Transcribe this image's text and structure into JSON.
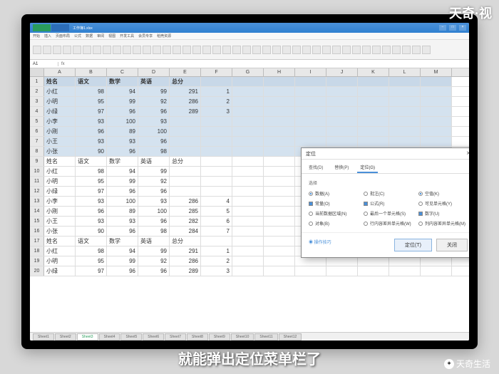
{
  "watermark_top": "天奇·视",
  "subtitle": "就能弹出定位菜单栏了",
  "watermark_bottom": "天奇生活",
  "titlebar": {
    "filename": "工作簿1.xlsx"
  },
  "menu": [
    "开始",
    "插入",
    "页面布局",
    "公式",
    "数据",
    "审阅",
    "视图",
    "开发工具",
    "会员专享",
    "稻壳资源"
  ],
  "cell_ref": "A1",
  "cols": [
    "A",
    "B",
    "C",
    "D",
    "E",
    "F",
    "G",
    "H",
    "I",
    "J",
    "K",
    "L",
    "M"
  ],
  "rows": [
    {
      "n": 1,
      "sel": true,
      "hdr": true,
      "c": [
        "姓名",
        "语文",
        "数学",
        "英语",
        "总分",
        "",
        "",
        "",
        "",
        "",
        "",
        "",
        ""
      ]
    },
    {
      "n": 2,
      "sel": true,
      "c": [
        "小红",
        "98",
        "94",
        "99",
        "291",
        "1",
        "",
        "",
        "",
        "",
        "",
        "",
        ""
      ]
    },
    {
      "n": 3,
      "sel": true,
      "c": [
        "小明",
        "95",
        "99",
        "92",
        "286",
        "2",
        "",
        "",
        "",
        "",
        "",
        "",
        ""
      ]
    },
    {
      "n": 4,
      "sel": true,
      "c": [
        "小绿",
        "97",
        "96",
        "96",
        "289",
        "3",
        "",
        "",
        "",
        "",
        "",
        "",
        ""
      ]
    },
    {
      "n": 5,
      "sel": true,
      "c": [
        "小李",
        "93",
        "100",
        "93",
        "",
        "",
        "",
        "",
        "",
        "",
        "",
        "",
        ""
      ]
    },
    {
      "n": 6,
      "sel": true,
      "c": [
        "小刚",
        "96",
        "89",
        "100",
        "",
        "",
        "",
        "",
        "",
        "",
        "",
        "",
        ""
      ]
    },
    {
      "n": 7,
      "sel": true,
      "c": [
        "小王",
        "93",
        "93",
        "96",
        "",
        "",
        "",
        "",
        "",
        "",
        "",
        "",
        ""
      ]
    },
    {
      "n": 8,
      "sel": true,
      "c": [
        "小张",
        "90",
        "96",
        "98",
        "",
        "",
        "",
        "",
        "",
        "",
        "",
        "",
        ""
      ]
    },
    {
      "n": 9,
      "c": [
        "姓名",
        "语文",
        "数学",
        "英语",
        "总分",
        "",
        "",
        "",
        "",
        "",
        "",
        "",
        ""
      ]
    },
    {
      "n": 10,
      "c": [
        "小红",
        "98",
        "94",
        "99",
        "",
        "",
        "",
        "",
        "",
        "",
        "",
        "",
        ""
      ]
    },
    {
      "n": 11,
      "c": [
        "小明",
        "95",
        "99",
        "92",
        "",
        "",
        "",
        "",
        "",
        "",
        "",
        "",
        ""
      ]
    },
    {
      "n": 12,
      "c": [
        "小绿",
        "97",
        "96",
        "96",
        "",
        "",
        "",
        "",
        "",
        "",
        "",
        "",
        ""
      ]
    },
    {
      "n": 13,
      "c": [
        "小李",
        "93",
        "100",
        "93",
        "286",
        "4",
        "",
        "",
        "",
        "",
        "",
        "",
        ""
      ]
    },
    {
      "n": 14,
      "c": [
        "小刚",
        "96",
        "89",
        "100",
        "285",
        "5",
        "",
        "",
        "",
        "",
        "",
        "",
        ""
      ]
    },
    {
      "n": 15,
      "c": [
        "小王",
        "93",
        "93",
        "96",
        "282",
        "6",
        "",
        "",
        "",
        "",
        "",
        "",
        ""
      ]
    },
    {
      "n": 16,
      "c": [
        "小张",
        "90",
        "96",
        "98",
        "284",
        "7",
        "",
        "",
        "",
        "",
        "",
        "",
        ""
      ]
    },
    {
      "n": 17,
      "c": [
        "姓名",
        "语文",
        "数学",
        "英语",
        "总分",
        "",
        "",
        "",
        "",
        "",
        "",
        "",
        ""
      ]
    },
    {
      "n": 18,
      "c": [
        "小红",
        "98",
        "94",
        "99",
        "291",
        "1",
        "",
        "",
        "",
        "",
        "",
        "",
        ""
      ]
    },
    {
      "n": 19,
      "c": [
        "小明",
        "95",
        "99",
        "92",
        "286",
        "2",
        "",
        "",
        "",
        "",
        "",
        "",
        ""
      ]
    },
    {
      "n": 20,
      "c": [
        "小绿",
        "97",
        "96",
        "96",
        "289",
        "3",
        "",
        "",
        "",
        "",
        "",
        "",
        ""
      ]
    }
  ],
  "sheets": [
    "Sheet1",
    "Sheet2",
    "Sheet3",
    "Sheet4",
    "Sheet5",
    "Sheet6",
    "Sheet7",
    "Sheet8",
    "Sheet9",
    "Sheet10",
    "Sheet11",
    "Sheet12"
  ],
  "active_sheet": 2,
  "dialog": {
    "title": "定位",
    "tabs": [
      "查找(D)",
      "替换(P)",
      "定位(G)"
    ],
    "section": "选择",
    "options": [
      {
        "label": "数据(A)",
        "type": "radio",
        "checked": true
      },
      {
        "label": "批注(C)",
        "type": "radio"
      },
      {
        "label": "空值(K)",
        "type": "radio",
        "checked": true
      },
      {
        "label": "常量(O)",
        "type": "check",
        "checked": true
      },
      {
        "label": "公式(R)",
        "type": "check",
        "checked": true
      },
      {
        "label": "可见单元格(Y)",
        "type": "radio"
      },
      {
        "label": "当前数据区域(N)",
        "type": "radio"
      },
      {
        "label": "最后一个单元格(S)",
        "type": "radio"
      },
      {
        "label": "数字(U)",
        "type": "check",
        "checked": true
      },
      {
        "label": "对象(B)",
        "type": "radio"
      },
      {
        "label": "行内容差异单元格(W)",
        "type": "radio"
      },
      {
        "label": "列内容差异单元格(M)",
        "type": "radio"
      }
    ],
    "help_link": "操作技巧",
    "btn_ok": "定位(T)",
    "btn_cancel": "关闭"
  }
}
